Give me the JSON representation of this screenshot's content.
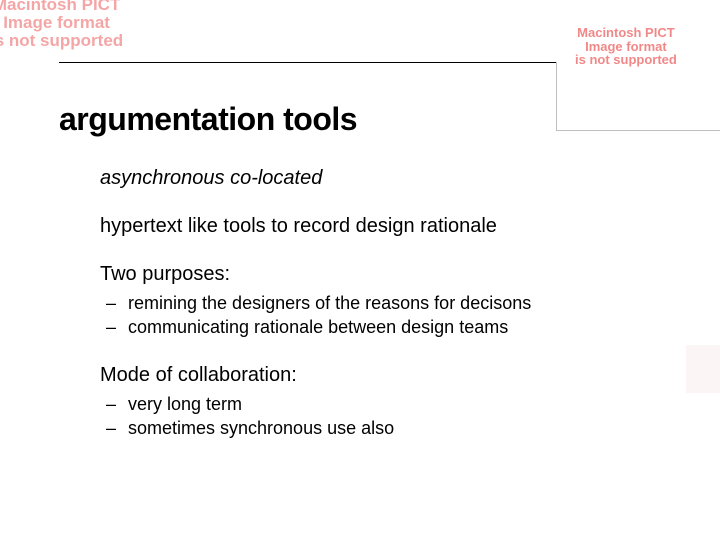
{
  "title": "argumentation tools",
  "line1": "asynchronous co-located",
  "line2": "hypertext like tools to record design rationale",
  "heading1": "Two purposes:",
  "bullets1": [
    "remining the designers of the reasons for decisons",
    "communicating rationale between design teams"
  ],
  "heading2": "Mode of collaboration:",
  "bullets2": [
    "very long term",
    "sometimes synchronous use also"
  ],
  "pict_err_l1": "Macintosh PICT",
  "pict_err_l2": "Image format",
  "pict_err_l3": "is not supported"
}
